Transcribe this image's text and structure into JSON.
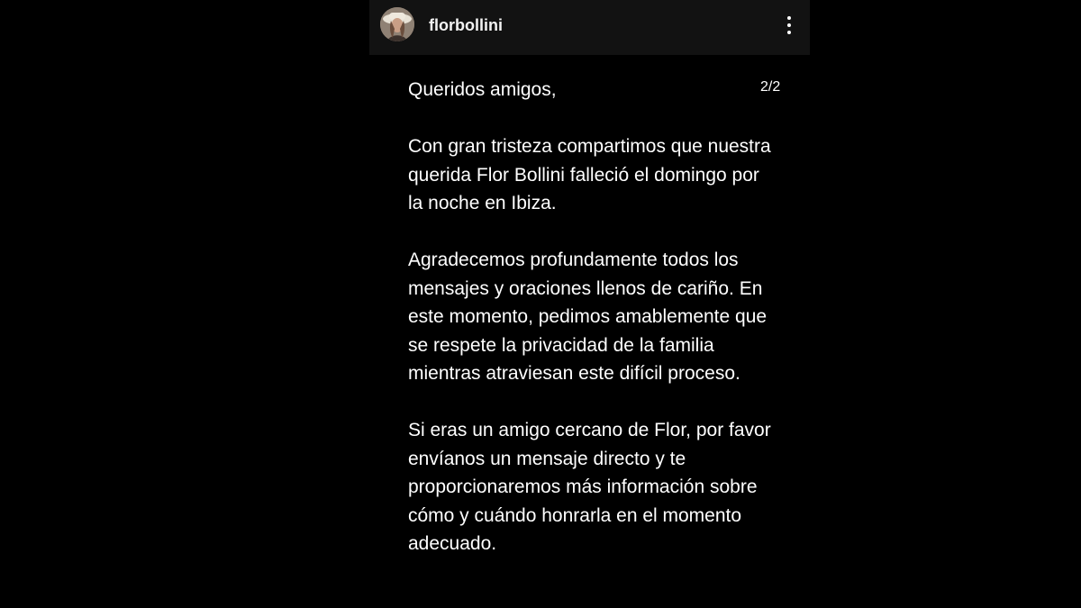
{
  "header": {
    "username": "florbollini",
    "avatar_icon": "profile-photo",
    "more_icon": "vertical-ellipsis-icon"
  },
  "post": {
    "page_counter": "2/2",
    "paragraphs": [
      "Queridos amigos,",
      "Con gran tristeza compartimos que nuestra querida Flor Bollini falleció el domingo por la noche en Ibiza.",
      "Agradecemos profundamente todos los mensajes y oraciones llenos de cariño. En este momento, pedimos amablemente que se respete la privacidad de la familia mientras atraviesan este difícil proceso.",
      "Si eras un amigo cercano de Flor, por favor envíanos un mensaje directo y te proporcionaremos más información sobre cómo y cuándo honrarla en el momento adecuado."
    ]
  },
  "colors": {
    "background": "#000000",
    "header_background": "#121212",
    "text": "#ffffff"
  }
}
